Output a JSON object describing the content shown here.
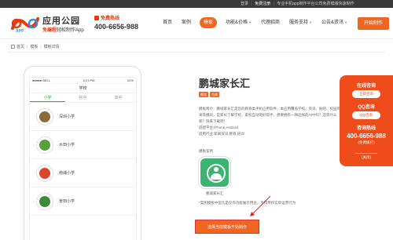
{
  "topbar": {
    "login": "登录",
    "free_register": "免费注册",
    "slogan": "专业手机app制作平台公司免费模版快速制作"
  },
  "brand": {
    "name": "应用公园",
    "slogan_prefix": "免编程",
    "slogan_suffix": "轻松制作App"
  },
  "hotline": {
    "label": "免费热线",
    "number": "400-6656-988"
  },
  "nav": {
    "items": [
      {
        "label": "首页",
        "active": false,
        "caret": false
      },
      {
        "label": "案例",
        "active": false,
        "caret": false
      },
      {
        "label": "模板",
        "active": true,
        "caret": false
      },
      {
        "label": "功能&价格",
        "active": false,
        "caret": true
      },
      {
        "label": "代理招商",
        "active": false,
        "caret": false
      },
      {
        "label": "服务支持",
        "active": false,
        "caret": true
      },
      {
        "label": "公告&资讯",
        "active": false,
        "caret": true
      }
    ],
    "start_button": "开始制作"
  },
  "breadcrumb": [
    "首页",
    "模板",
    "模板详情"
  ],
  "phone": {
    "status_left": "●●●●● BELL",
    "status_time": "4:21 PM",
    "status_right": "22%",
    "title": "学校",
    "tabs": [
      {
        "label": "小学",
        "active": true
      },
      {
        "label": "初中",
        "active": false
      },
      {
        "label": "高中",
        "active": false
      }
    ],
    "schools": [
      {
        "name": "深圳小学",
        "color": "#8b6a3a"
      },
      {
        "name": "水田小学",
        "color": "#5b9e3c"
      },
      {
        "name": "南浦小学",
        "color": "#d9462b"
      },
      {
        "name": "景田小学",
        "color": "#3a8a3a"
      }
    ]
  },
  "detail": {
    "app_name": "鹏城家长汇",
    "tags": [
      "教育",
      "古典"
    ],
    "desc_intro": "模板简介：鹏城家长汇是您的教育类手机应用软件，本应用覆盖学校、资讯、贴吧、校园风采等模块，是家长了解学校，家校互动的好帮手，想要拥有一款这样的APP吗？还等什么呢？快来下载吧！",
    "desc_platform": "适配平台:iPhone,Android",
    "desc_industry": "适用行业:新闻资讯,教育,培训",
    "case_label": "模板案例",
    "case_name": "鹏城家长汇",
    "note": "*案例模板中但凡是仅作功能展示用途，不得用作实际运营行为",
    "make_button": "选择当前模板开始制作"
  },
  "float_panel": {
    "online_title": "在线咨询",
    "consult_button": "立即咨询",
    "qq_title": "QQ咨询",
    "qq_button": "QQ咨询",
    "phone_title": "咨询热线",
    "phone_number": "400-6656-988",
    "free_note": "(免费拨打)",
    "close": "[关闭]"
  },
  "colors": {
    "accent": "#f06522",
    "panel": "#ee4c1b",
    "topbar": "#3a3a3a",
    "green": "#3db371"
  }
}
